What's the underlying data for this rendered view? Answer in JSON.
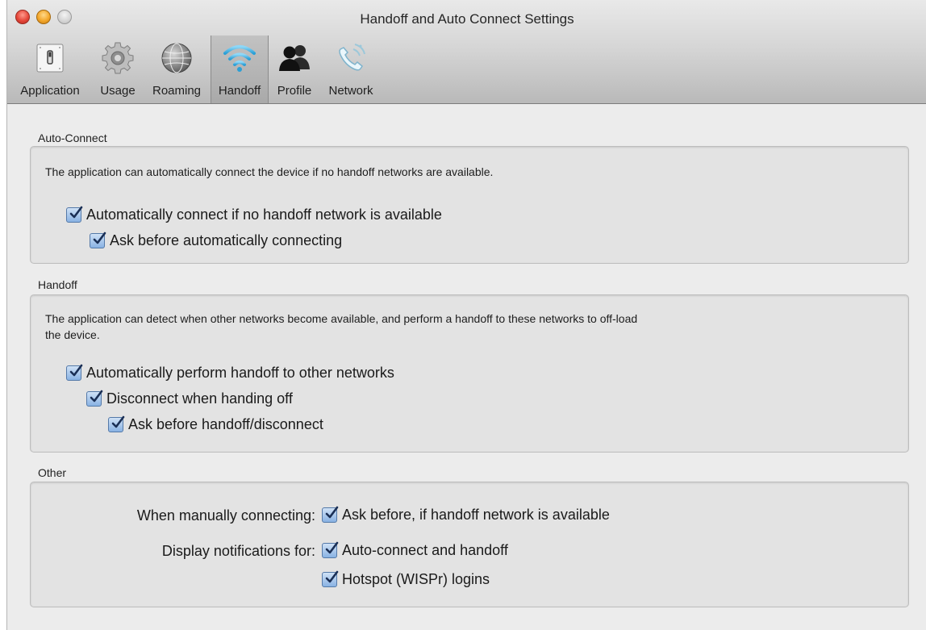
{
  "window": {
    "title": "Handoff and Auto Connect Settings"
  },
  "toolbar": {
    "items": [
      {
        "label": "Application",
        "icon": "switch-icon"
      },
      {
        "label": "Usage",
        "icon": "gear-icon"
      },
      {
        "label": "Roaming",
        "icon": "globe-icon"
      },
      {
        "label": "Handoff",
        "icon": "wifi-icon",
        "selected": true
      },
      {
        "label": "Profile",
        "icon": "people-icon"
      },
      {
        "label": "Network",
        "icon": "phone-icon"
      }
    ]
  },
  "auto_connect": {
    "title": "Auto-Connect",
    "description": "The application can automatically connect the device if no handoff networks are available.",
    "options": [
      {
        "label": "Automatically connect if no handoff network is available",
        "checked": true
      },
      {
        "label": "Ask before automatically connecting",
        "checked": true
      }
    ]
  },
  "handoff": {
    "title": "Handoff",
    "description_line1": "The application can detect when other networks become available, and perform a handoff to these networks to off-load",
    "description_line2": "the device.",
    "options": [
      {
        "label": "Automatically perform handoff to other networks",
        "checked": true
      },
      {
        "label": "Disconnect when handing off",
        "checked": true
      },
      {
        "label": "Ask before handoff/disconnect",
        "checked": true
      }
    ]
  },
  "other": {
    "title": "Other",
    "manual_label": "When manually connecting:",
    "manual_option": {
      "label": "Ask before, if handoff network is available",
      "checked": true
    },
    "notify_label": "Display notifications for:",
    "notify_options": [
      {
        "label": "Auto-connect and handoff",
        "checked": true
      },
      {
        "label": "Hotspot (WISPr) logins",
        "checked": true
      }
    ]
  },
  "colors": {
    "selected_tab": "#b4b4b4",
    "checkbox_fill": "#89b2e3",
    "window_bg": "#ececec"
  }
}
